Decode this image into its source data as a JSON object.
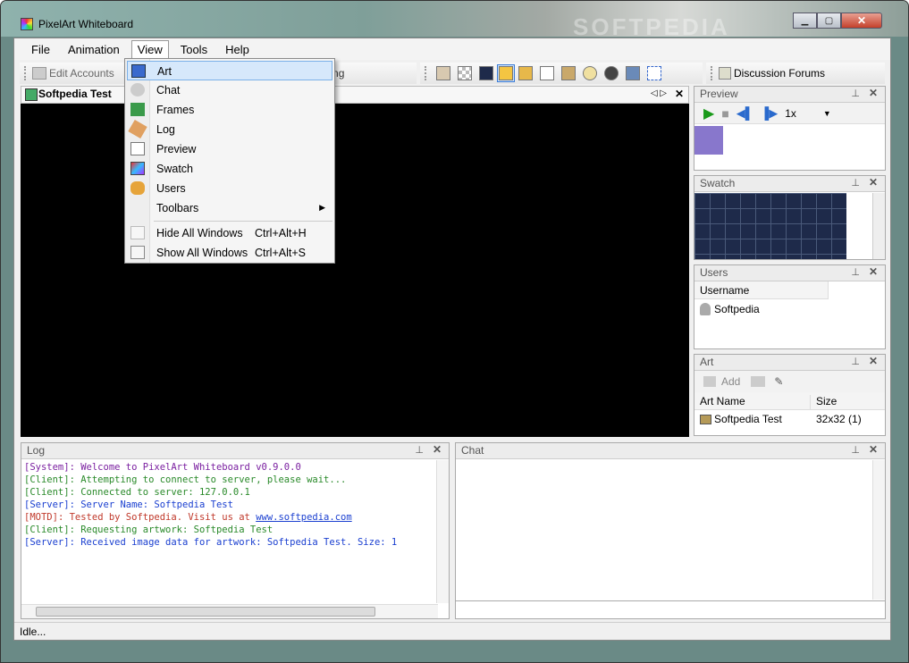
{
  "window": {
    "title": "PixelArt Whiteboard",
    "watermark": "SOFTPEDIA"
  },
  "menubar": {
    "file": "File",
    "animation": "Animation",
    "view": "View",
    "tools": "Tools",
    "help": "Help"
  },
  "toolbar": {
    "edit_accounts": "Edit Accounts",
    "partial_label": "hing",
    "discussion": "Discussion Forums"
  },
  "document": {
    "tab": "Softpedia Test"
  },
  "view_menu": {
    "items": [
      {
        "label": "Art"
      },
      {
        "label": "Chat"
      },
      {
        "label": "Frames"
      },
      {
        "label": "Log"
      },
      {
        "label": "Preview"
      },
      {
        "label": "Swatch"
      },
      {
        "label": "Users"
      },
      {
        "label": "Toolbars"
      }
    ],
    "hide_all": {
      "label": "Hide All Windows",
      "shortcut": "Ctrl+Alt+H"
    },
    "show_all": {
      "label": "Show All Windows",
      "shortcut": "Ctrl+Alt+S"
    }
  },
  "preview": {
    "title": "Preview",
    "speed": "1x"
  },
  "swatch": {
    "title": "Swatch"
  },
  "users": {
    "title": "Users",
    "col": "Username",
    "user": "Softpedia"
  },
  "art": {
    "title": "Art",
    "add": "Add",
    "col_name": "Art Name",
    "col_size": "Size",
    "row_name": "Softpedia Test",
    "row_size": "32x32 (1)"
  },
  "log": {
    "title": "Log",
    "lines": [
      {
        "tag": "[System]",
        "text": ": Welcome to PixelArt Whiteboard v0.9.0.0",
        "color": "#7a1fa0"
      },
      {
        "tag": "[Client]",
        "text": ": Attempting to connect to server, please wait...",
        "color": "#2a8a2a"
      },
      {
        "tag": "[Client]",
        "text": ": Connected to server: 127.0.0.1",
        "color": "#2a8a2a"
      },
      {
        "tag": "[Server]",
        "text": ": Server Name: Softpedia Test",
        "color": "#1a3fd0"
      },
      {
        "tag": "[MOTD]",
        "text": ": Tested by Softpedia. Visit us at ",
        "link": "www.softpedia.com",
        "color": "#c0392b"
      },
      {
        "tag": "[Client]",
        "text": ": Requesting artwork: Softpedia Test",
        "color": "#2a8a2a"
      },
      {
        "tag": "[Server]",
        "text": ": Received image data for artwork: Softpedia Test. Size: 1",
        "color": "#1a3fd0"
      }
    ]
  },
  "chat": {
    "title": "Chat"
  },
  "status": {
    "text": "Idle..."
  }
}
